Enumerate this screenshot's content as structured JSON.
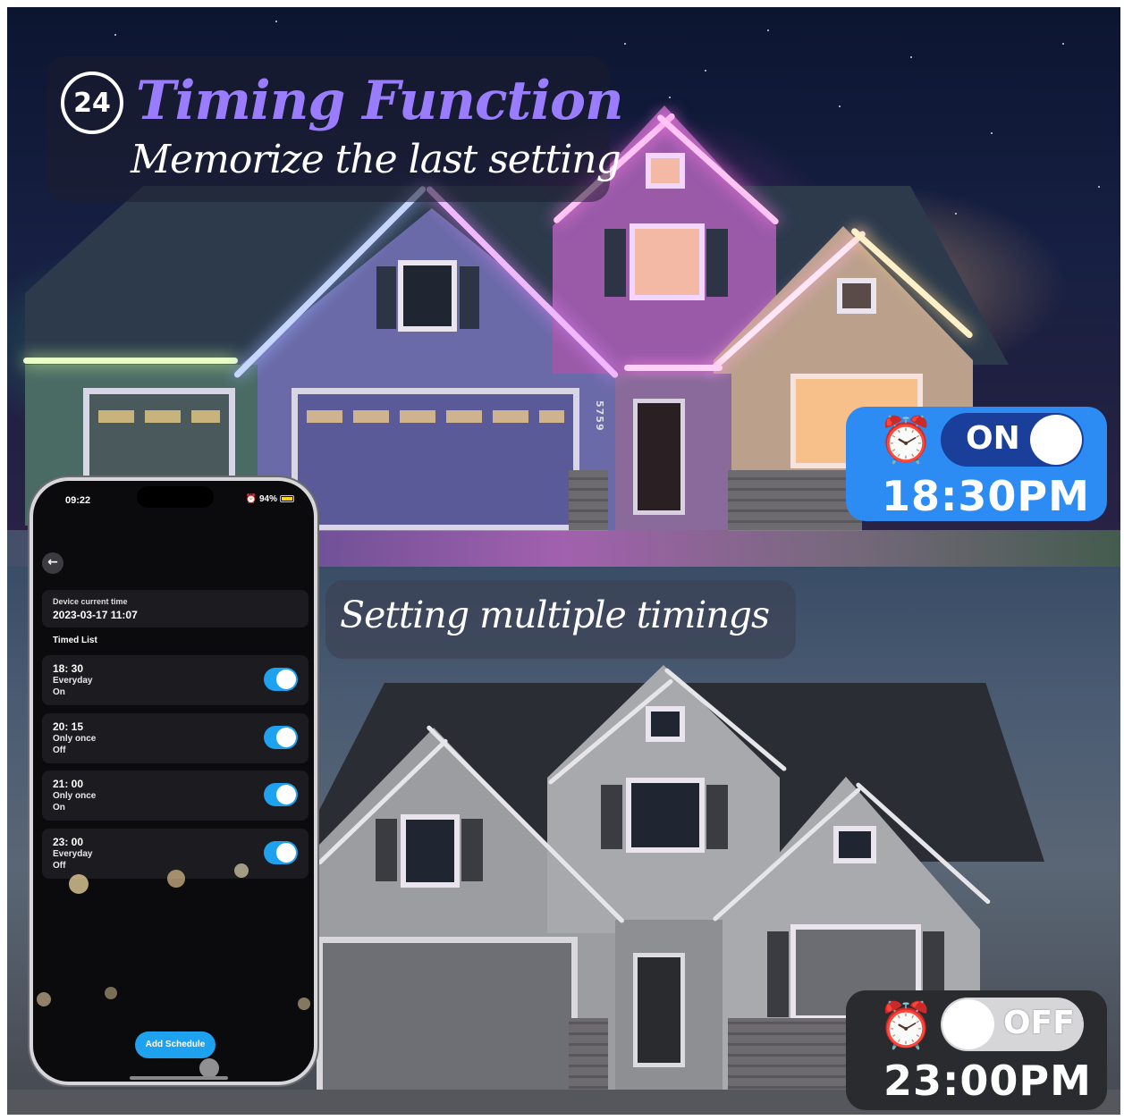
{
  "header": {
    "icon_number": "24",
    "title": "Timing Function",
    "subtitle": "Memorize the last setting"
  },
  "section2": {
    "subtitle": "Setting multiple timings"
  },
  "house": {
    "address_number": "5759"
  },
  "badge_on": {
    "icon": "alarm-clock-icon",
    "state": "ON",
    "time": "18:30PM",
    "color": "#2c8cf3"
  },
  "badge_off": {
    "icon": "alarm-clock-icon",
    "state": "OFF",
    "time": "23:00PM",
    "color": "#2a2b2e"
  },
  "phone": {
    "status_time": "09:22",
    "battery": "94%",
    "device_time_label": "Device current time",
    "device_time_value": "2023-03-17 11:07",
    "timed_list_label": "Timed List",
    "timers": [
      {
        "time": "18: 30",
        "repeat": "Everyday",
        "action": "On",
        "enabled": true
      },
      {
        "time": "20: 15",
        "repeat": "Only once",
        "action": "Off",
        "enabled": true
      },
      {
        "time": "21: 00",
        "repeat": "Only once",
        "action": "On",
        "enabled": true
      },
      {
        "time": "23: 00",
        "repeat": "Everyday",
        "action": "Off",
        "enabled": true
      }
    ],
    "add_button": "Add Schedule",
    "accent": "#1ea2f0"
  }
}
